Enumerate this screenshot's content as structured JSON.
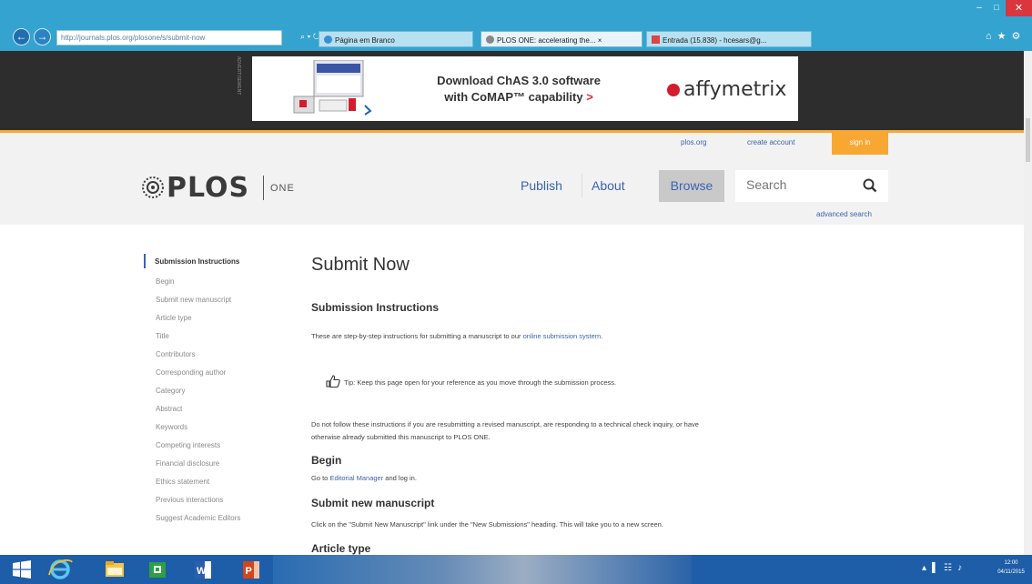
{
  "browser": {
    "address": "http://journals.plos.org/plosone/s/submit-now",
    "address_tools": "⌕ ▾ ↻",
    "tabs": [
      {
        "label": "Página em Branco"
      },
      {
        "label": "PLOS ONE: accelerating the... ×"
      },
      {
        "label": "Entrada (15.838) - hcesars@g..."
      }
    ],
    "window_min": "–",
    "window_max": "□",
    "window_close": "✕",
    "chrome_icons": "⌂★⚙"
  },
  "ad": {
    "side_text": "ADVERTISEMENT",
    "line1": "Download ChAS 3.0 software",
    "line2": "with CoMAP™ capability",
    "chevron": ">",
    "logo": "affymetrix"
  },
  "header": {
    "plos_link": "plos.org",
    "create_account": "create account",
    "sign_in": "sign in",
    "logo_text": "PLOS",
    "logo_sub": "ONE",
    "nav": {
      "publish": "Publish",
      "about": "About",
      "browse": "Browse"
    },
    "search_placeholder": "Search",
    "advanced_search": "advanced search"
  },
  "sidebar": {
    "items": [
      "Submission Instructions",
      "Begin",
      "Submit new manuscript",
      "Article type",
      "Title",
      "Contributors",
      "Corresponding author",
      "Category",
      "Abstract",
      "Keywords",
      "Competing interests",
      "Financial disclosure",
      "Ethics statement",
      "Previous interactions",
      "Suggest Academic Editors"
    ]
  },
  "main": {
    "title": "Submit Now",
    "h_instructions": "Submission Instructions",
    "intro_pre": "These are step-by-step instructions for submitting a manuscript to our ",
    "intro_link": "online submission system",
    "intro_post": ".",
    "tip_label": "Tip:",
    "tip_text": "Keep this page open for your reference as you move through the submission process.",
    "resubmit_line1": "Do not follow these instructions if you are resubmitting a revised manuscript, are responding to a technical check inquiry, or have",
    "resubmit_line2": "otherwise already submitted this manuscript to PLOS ONE.",
    "h_begin": "Begin",
    "begin_pre": "Go to ",
    "begin_link": "Editorial Manager",
    "begin_post": " and log in.",
    "h_submit_new": "Submit new manuscript",
    "submit_new_text": "Click on the \"Submit New Manuscript\" link under the \"New Submissions\" heading. This will take you to a new screen.",
    "h_article_type": "Article type"
  },
  "taskbar": {
    "tray_icons": "▴▌☷♪",
    "clock_time": "12:00",
    "clock_date": "04/11/2015"
  }
}
